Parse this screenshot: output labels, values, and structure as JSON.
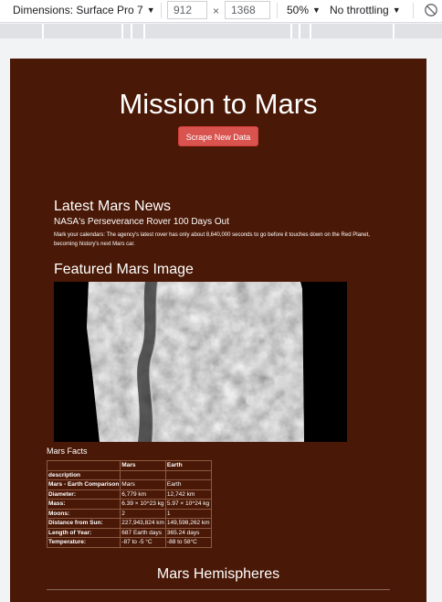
{
  "devtools": {
    "device_label": "Dimensions: Surface Pro 7",
    "width_value": "912",
    "times_sign": "×",
    "height_value": "1368",
    "zoom_label": "50%",
    "throttle_label": "No throttling"
  },
  "page": {
    "title": "Mission to Mars",
    "scrape_button": "Scrape New Data",
    "news_heading": "Latest Mars News",
    "news_title": "NASA's Perseverance Rover 100 Days Out",
    "news_paragraph": "Mark your calendars: The agency's latest rover has only about 8,640,000 seconds to go before it touches down on the Red Planet, becoming history's next Mars car.",
    "image_heading": "Featured Mars Image",
    "facts_caption": "Mars Facts",
    "hemispheres_heading": "Mars Hemispheres"
  },
  "facts_table": {
    "headers": [
      "",
      "Mars",
      "Earth"
    ],
    "index_label": "description",
    "rows": [
      {
        "label": "Mars - Earth Comparison",
        "mars": "Mars",
        "earth": "Earth"
      },
      {
        "label": "Diameter:",
        "mars": "6,779 km",
        "earth": "12,742 km"
      },
      {
        "label": "Mass:",
        "mars": "6.39 × 10^23 kg",
        "earth": "5.97 × 10^24 kg"
      },
      {
        "label": "Moons:",
        "mars": "2",
        "earth": "1"
      },
      {
        "label": "Distance from Sun:",
        "mars": "227,943,824 km",
        "earth": "149,598,262 km"
      },
      {
        "label": "Length of Year:",
        "mars": "687 Earth days",
        "earth": "365.24 days"
      },
      {
        "label": "Temperature:",
        "mars": "-87 to -5 °C",
        "earth": "-88 to 58°C"
      }
    ]
  },
  "colors": {
    "page_background": "#4a1806",
    "button": "#d9534f"
  }
}
